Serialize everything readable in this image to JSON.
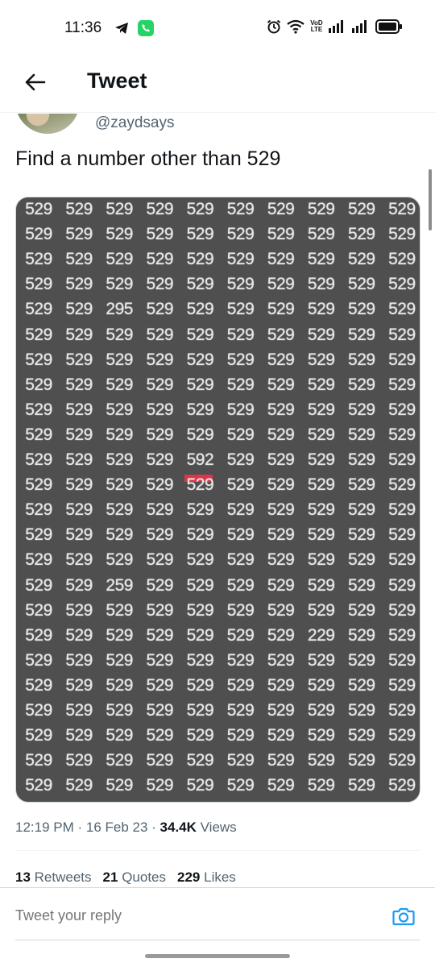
{
  "status_bar": {
    "time": "11:36",
    "volte_line1": "VoD",
    "volte_line2": "LTE"
  },
  "header": {
    "title": "Tweet"
  },
  "tweet": {
    "handle": "@zaydsays",
    "text": "Find a number other than 529",
    "image_grid": [
      [
        "529",
        "529",
        "529",
        "529",
        "529",
        "529",
        "529",
        "529",
        "529",
        "529"
      ],
      [
        "529",
        "529",
        "529",
        "529",
        "529",
        "529",
        "529",
        "529",
        "529",
        "529"
      ],
      [
        "529",
        "529",
        "529",
        "529",
        "529",
        "529",
        "529",
        "529",
        "529",
        "529"
      ],
      [
        "529",
        "529",
        "529",
        "529",
        "529",
        "529",
        "529",
        "529",
        "529",
        "529"
      ],
      [
        "529",
        "529",
        "295",
        "529",
        "529",
        "529",
        "529",
        "529",
        "529",
        "529"
      ],
      [
        "529",
        "529",
        "529",
        "529",
        "529",
        "529",
        "529",
        "529",
        "529",
        "529"
      ],
      [
        "529",
        "529",
        "529",
        "529",
        "529",
        "529",
        "529",
        "529",
        "529",
        "529"
      ],
      [
        "529",
        "529",
        "529",
        "529",
        "529",
        "529",
        "529",
        "529",
        "529",
        "529"
      ],
      [
        "529",
        "529",
        "529",
        "529",
        "529",
        "529",
        "529",
        "529",
        "529",
        "529"
      ],
      [
        "529",
        "529",
        "529",
        "529",
        "529",
        "529",
        "529",
        "529",
        "529",
        "529"
      ],
      [
        "529",
        "529",
        "529",
        "529",
        "592",
        "529",
        "529",
        "529",
        "529",
        "529"
      ],
      [
        "529",
        "529",
        "529",
        "529",
        "529",
        "529",
        "529",
        "529",
        "529",
        "529"
      ],
      [
        "529",
        "529",
        "529",
        "529",
        "529",
        "529",
        "529",
        "529",
        "529",
        "529"
      ],
      [
        "529",
        "529",
        "529",
        "529",
        "529",
        "529",
        "529",
        "529",
        "529",
        "529"
      ],
      [
        "529",
        "529",
        "529",
        "529",
        "529",
        "529",
        "529",
        "529",
        "529",
        "529"
      ],
      [
        "529",
        "529",
        "259",
        "529",
        "529",
        "529",
        "529",
        "529",
        "529",
        "529"
      ],
      [
        "529",
        "529",
        "529",
        "529",
        "529",
        "529",
        "529",
        "529",
        "529",
        "529"
      ],
      [
        "529",
        "529",
        "529",
        "529",
        "529",
        "529",
        "529",
        "229",
        "529",
        "529"
      ],
      [
        "529",
        "529",
        "529",
        "529",
        "529",
        "529",
        "529",
        "529",
        "529",
        "529"
      ],
      [
        "529",
        "529",
        "529",
        "529",
        "529",
        "529",
        "529",
        "529",
        "529",
        "529"
      ],
      [
        "529",
        "529",
        "529",
        "529",
        "529",
        "529",
        "529",
        "529",
        "529",
        "529"
      ],
      [
        "529",
        "529",
        "529",
        "529",
        "529",
        "529",
        "529",
        "529",
        "529",
        "529"
      ],
      [
        "529",
        "529",
        "529",
        "529",
        "529",
        "529",
        "529",
        "529",
        "529",
        "529"
      ],
      [
        "529",
        "529",
        "529",
        "529",
        "529",
        "529",
        "529",
        "529",
        "529",
        "529"
      ]
    ],
    "highlight_color": "#e0344a",
    "timestamp": "12:19 PM · 16 Feb 23 · ",
    "views_count": "34.4K",
    "views_label": " Views",
    "stats": {
      "retweets_count": "13",
      "retweets_label": "Retweets",
      "quotes_count": "21",
      "quotes_label": "Quotes",
      "likes_count": "229",
      "likes_label": "Likes"
    }
  },
  "reply": {
    "placeholder": "Tweet your reply"
  },
  "colors": {
    "accent": "#1d9bf0",
    "secondary_text": "#536471",
    "image_background": "#4f4f4f"
  },
  "icons": [
    "telegram-icon",
    "whatsapp-icon",
    "alarm-icon",
    "wifi-icon",
    "signal-icon",
    "battery-icon",
    "back-arrow-icon",
    "camera-icon"
  ]
}
